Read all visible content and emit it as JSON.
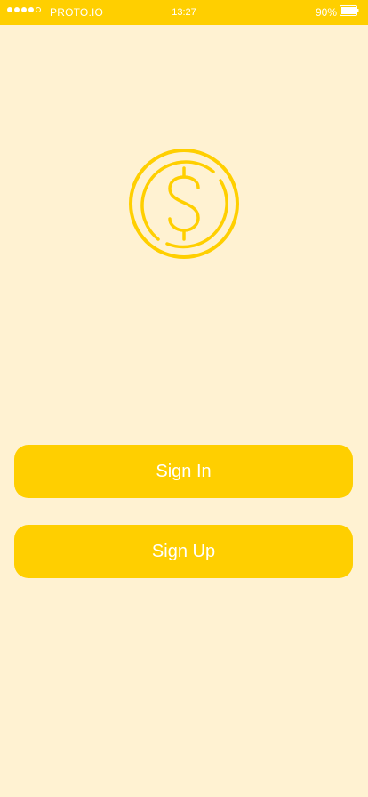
{
  "status_bar": {
    "carrier": "PROTO.IO",
    "time": "13:27",
    "battery": "90%",
    "signal_bars": 4,
    "signal_total": 5,
    "battery_level": 0.9
  },
  "logo": {
    "icon": "dollar-coin-icon"
  },
  "buttons": {
    "sign_in": "Sign In",
    "sign_up": "Sign Up"
  },
  "colors": {
    "background": "#FFF2D2",
    "accent": "#FFCF00",
    "text_on_accent": "#FFFFFF"
  }
}
